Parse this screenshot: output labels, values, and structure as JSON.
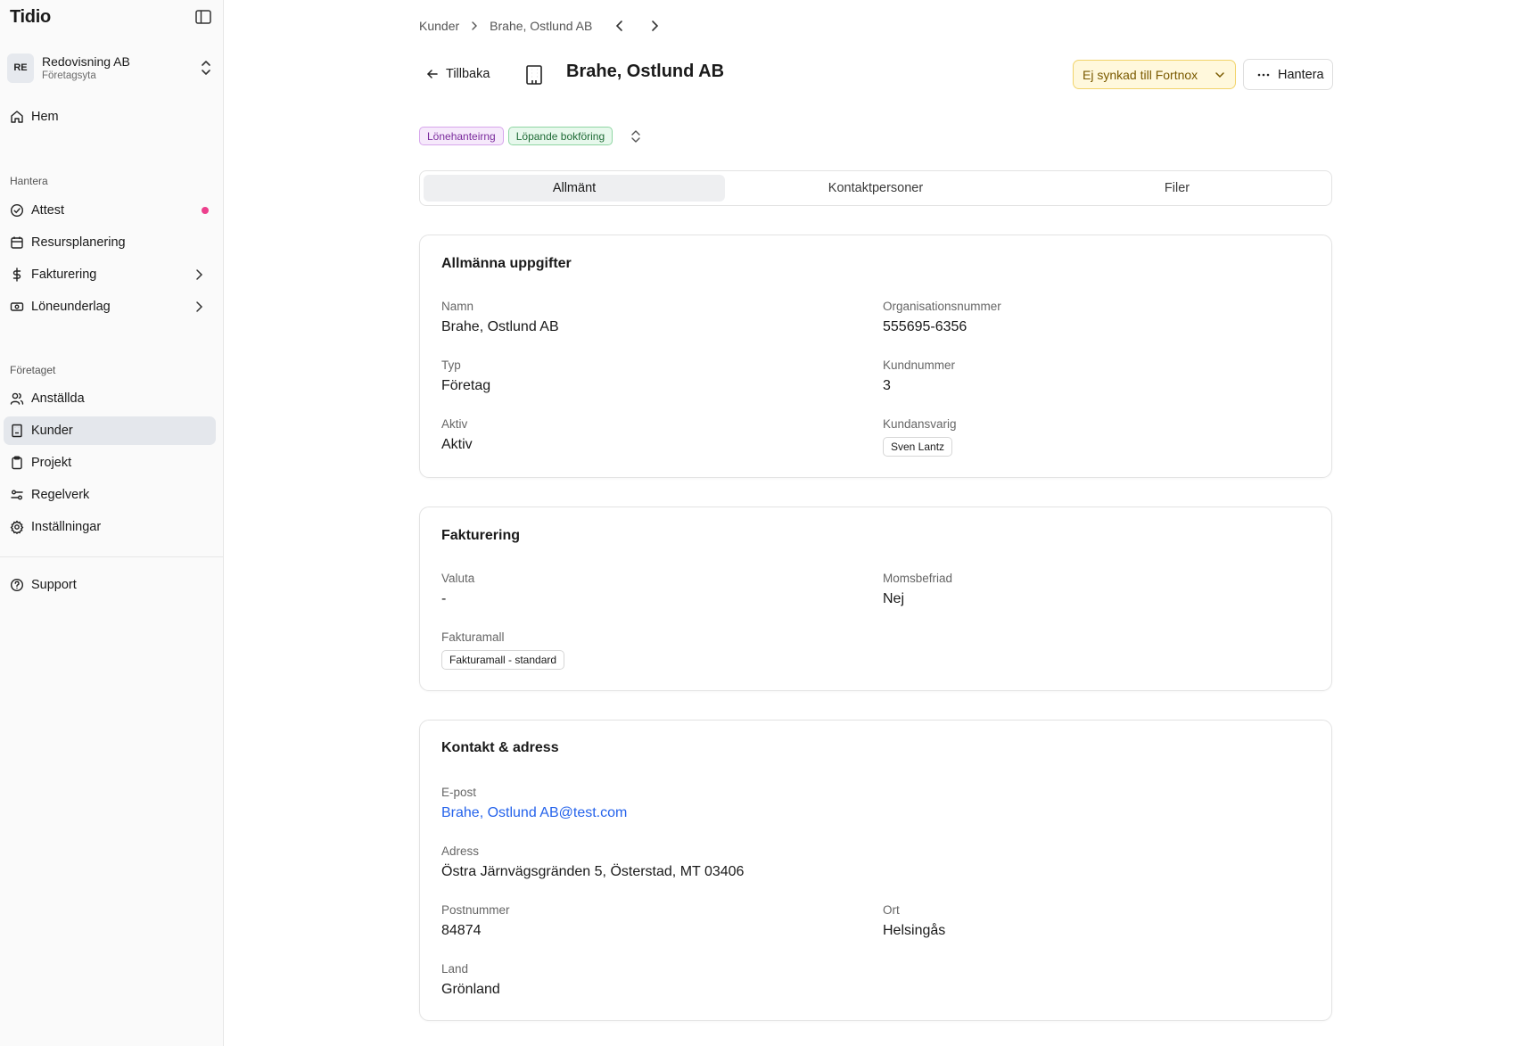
{
  "app": {
    "brand": "Tidio"
  },
  "org": {
    "initials": "RE",
    "name": "Redovisning AB",
    "subtitle": "Företagsyta"
  },
  "sidebar": {
    "home": "Hem",
    "section_manage": "Hantera",
    "manage_items": [
      {
        "label": "Attest",
        "icon": "check-circle-icon"
      },
      {
        "label": "Resursplanering",
        "icon": "calendar-icon"
      },
      {
        "label": "Fakturering",
        "icon": "dollar-icon"
      },
      {
        "label": "Löneunderlag",
        "icon": "banknote-icon"
      }
    ],
    "section_company": "Företaget",
    "company_items": [
      {
        "label": "Anställda",
        "icon": "users-icon"
      },
      {
        "label": "Kunder",
        "icon": "building-icon"
      },
      {
        "label": "Projekt",
        "icon": "clipboard-icon"
      },
      {
        "label": "Regelverk",
        "icon": "sliders-icon"
      },
      {
        "label": "Inställningar",
        "icon": "gear-icon"
      }
    ],
    "support": "Support"
  },
  "breadcrumb": {
    "root": "Kunder",
    "current": "Brahe, Ostlund AB"
  },
  "header": {
    "back_label": "Tillbaka",
    "title": "Brahe, Ostlund AB",
    "sync_label": "Ej synkad till Fortnox",
    "manage_label": "Hantera"
  },
  "tags": [
    "Lönehanteirng",
    "Löpande bokföring"
  ],
  "tabs": [
    "Allmänt",
    "Kontaktpersoner",
    "Filer"
  ],
  "general": {
    "title": "Allmänna uppgifter",
    "name_label": "Namn",
    "name": "Brahe, Ostlund AB",
    "org_label": "Organisationsnummer",
    "org": "555695-6356",
    "type_label": "Typ",
    "type": "Företag",
    "customer_no_label": "Kundnummer",
    "customer_no": "3",
    "active_label": "Aktiv",
    "active": "Aktiv",
    "responsible_label": "Kundansvarig",
    "responsible": "Sven Lantz"
  },
  "billing": {
    "title": "Fakturering",
    "currency_label": "Valuta",
    "currency": "-",
    "vat_label": "Momsbefriad",
    "vat": "Nej",
    "template_label": "Fakturamall",
    "template": "Fakturamall - standard"
  },
  "contact": {
    "title": "Kontakt & adress",
    "email_label": "E-post",
    "email": "Brahe, Ostlund AB@test.com",
    "address_label": "Adress",
    "address": "Östra Järnvägsgränden 5, Österstad, MT 03406",
    "zip_label": "Postnummer",
    "zip": "84874",
    "city_label": "Ort",
    "city": "Helsingås",
    "country_label": "Land",
    "country": "Grönland"
  },
  "colors": {
    "accent_link": "#2563eb",
    "notification_dot": "#ec3f8c",
    "sync_warning": "#fff8dc"
  }
}
